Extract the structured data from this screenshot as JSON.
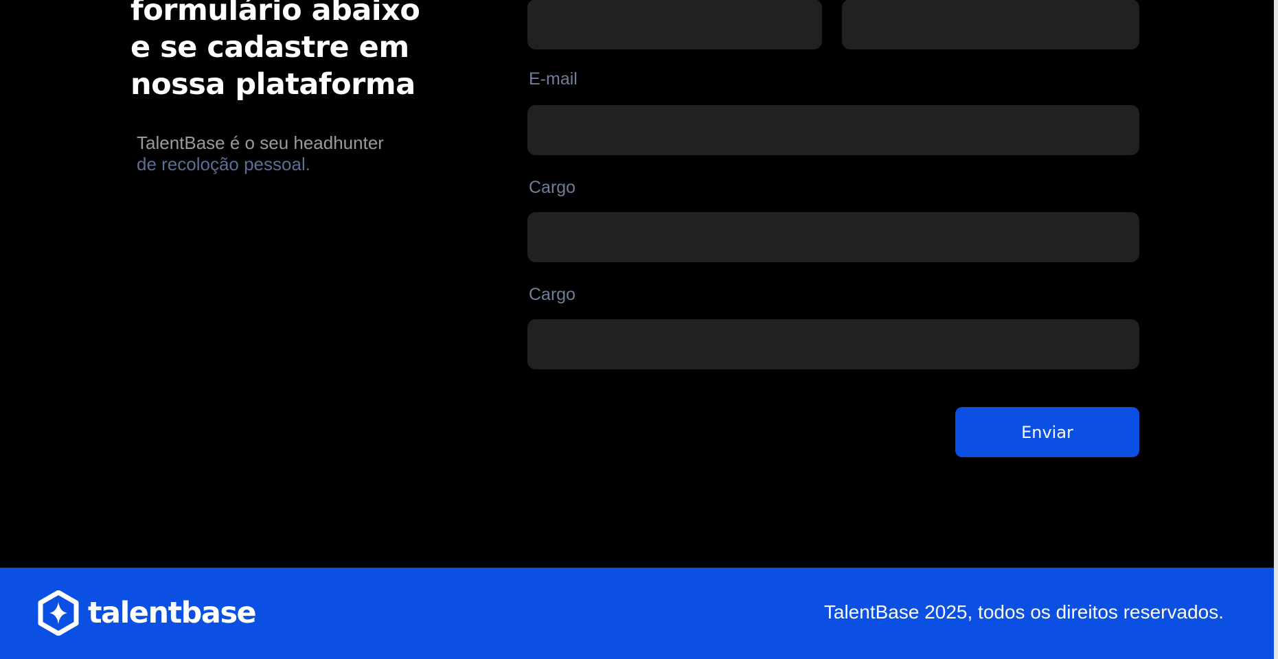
{
  "colors": {
    "background": "#000000",
    "input_bg": "#212121",
    "label": "#6f7f99",
    "brand_blue": "#0b50e2",
    "subtitle_gray": "#9a9a9a",
    "subtitle_blue": "#5b6f94"
  },
  "hero": {
    "heading_lines": [
      "formulário abaixo",
      "e se cadastre em",
      "nossa plataforma"
    ],
    "subtitle_lines": [
      "TalentBase é o seu headhunter",
      "de recoloção pessoal."
    ]
  },
  "form": {
    "email_label": "E-mail",
    "cargo_label_1": "Cargo",
    "cargo_label_2": "Cargo",
    "submit_label": "Enviar"
  },
  "footer": {
    "logo_icon": "hexagon-star-icon",
    "brand_name": "talentbase",
    "copyright": "TalentBase 2025, todos os direitos reservados."
  }
}
